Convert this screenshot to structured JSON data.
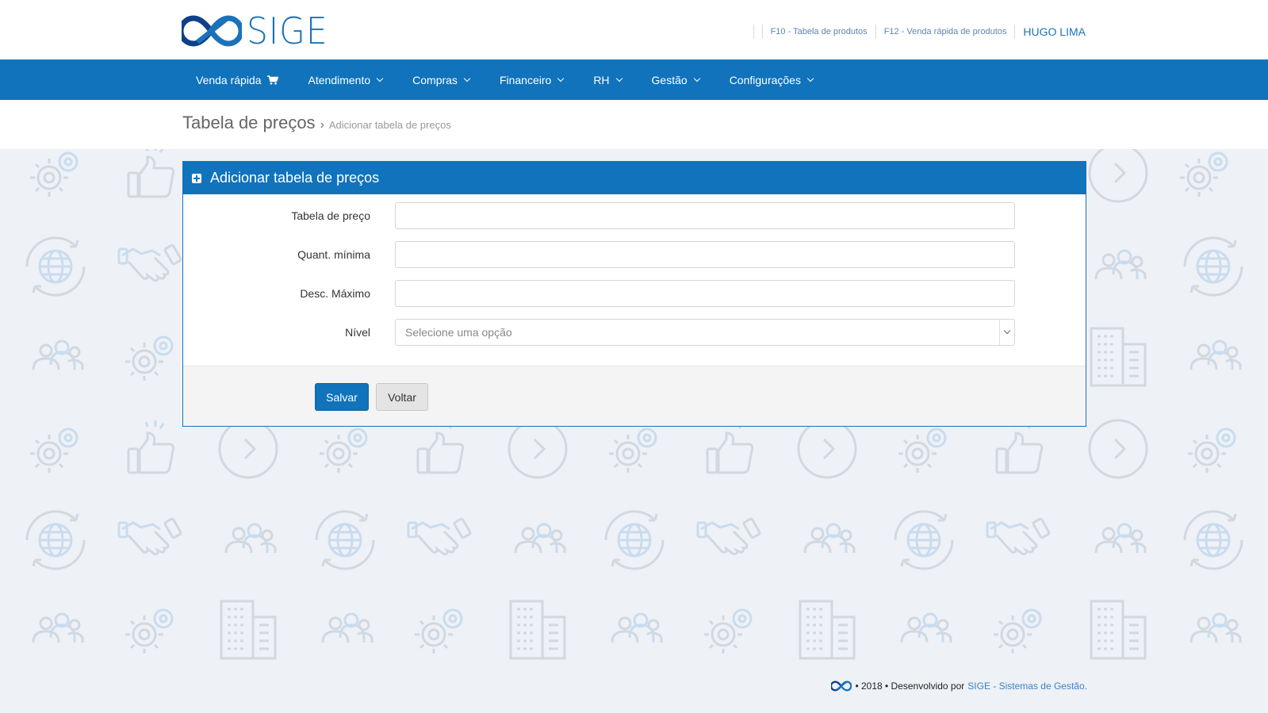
{
  "header": {
    "logo_text": "SIGE",
    "links": [
      {
        "label": "F10 - Tabela de produtos"
      },
      {
        "label": "F12 - Venda rápida de produtos"
      }
    ],
    "user": "HUGO LIMA"
  },
  "nav": {
    "items": [
      {
        "label": "Venda rápida",
        "icon": "cart-icon"
      },
      {
        "label": "Atendimento",
        "icon": "chevron-down-icon"
      },
      {
        "label": "Compras",
        "icon": "chevron-down-icon"
      },
      {
        "label": "Financeiro",
        "icon": "chevron-down-icon"
      },
      {
        "label": "RH",
        "icon": "chevron-down-icon"
      },
      {
        "label": "Gestão",
        "icon": "chevron-down-icon"
      },
      {
        "label": "Configurações",
        "icon": "chevron-down-icon"
      }
    ]
  },
  "breadcrumb": {
    "title": "Tabela de preços",
    "separator": "›",
    "current": "Adicionar tabela de preços"
  },
  "panel": {
    "title": "Adicionar tabela de preços",
    "fields": {
      "tabela": {
        "label": "Tabela de preço",
        "value": ""
      },
      "quant": {
        "label": "Quant. mínima",
        "value": ""
      },
      "desc": {
        "label": "Desc. Máximo",
        "value": ""
      },
      "nivel": {
        "label": "Nível",
        "placeholder": "Selecione uma opção"
      }
    },
    "save_label": "Salvar",
    "back_label": "Voltar"
  },
  "footer": {
    "text": "• 2018 • Desenvolvido por",
    "link": "SIGE - Sistemas de Gestão."
  },
  "colors": {
    "primary": "#1073bb",
    "background": "#eef1f6",
    "pattern_gray": "#d3d8df",
    "pattern_blue": "#c9dcef"
  }
}
